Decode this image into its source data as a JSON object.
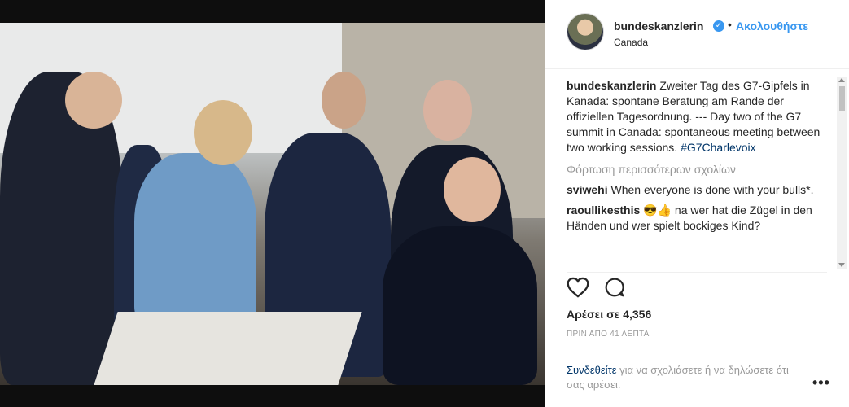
{
  "post": {
    "image_alt": "G7 leaders meeting around a table",
    "username": "bundeskanzlerin",
    "follow_label": "Ακολουθήστε",
    "separator": "•",
    "location": "Canada",
    "caption_user": "bundeskanzlerin",
    "caption": "Zweiter Tag des G7-Gipfels in Kanada: spontane Beratung am Rande der offiziellen Tagesordnung. --- Day two of the G7 summit in Canada: spontaneous meeting between two working sessions.",
    "caption_hashtag": "#G7Charlevoix",
    "load_more": "Φόρτωση περισσότερων σχολίων",
    "comments": [
      {
        "user": "sviwehi",
        "text": "When everyone is done with your bulls*."
      },
      {
        "user": "raoullikesthis",
        "text": "😎👍 na wer hat die Zügel in den Händen und wer spielt bockiges Kind?"
      }
    ],
    "likes": "Αρέσει σε 4,356",
    "time_ago": "ΠΡΙΝ ΑΠΟ 41 ΛΕΠΤΑ",
    "login_link": "Συνδεθείτε",
    "login_rest": " για να σχολιάσετε ή να δηλώσετε ότι σας αρέσει.",
    "more_icon": "ellipsis-icon",
    "icons": [
      "heart-icon",
      "comment-icon",
      "verified-badge-icon"
    ]
  },
  "colors": {
    "accent": "#3897f0",
    "link": "#003569",
    "muted": "#999999"
  }
}
